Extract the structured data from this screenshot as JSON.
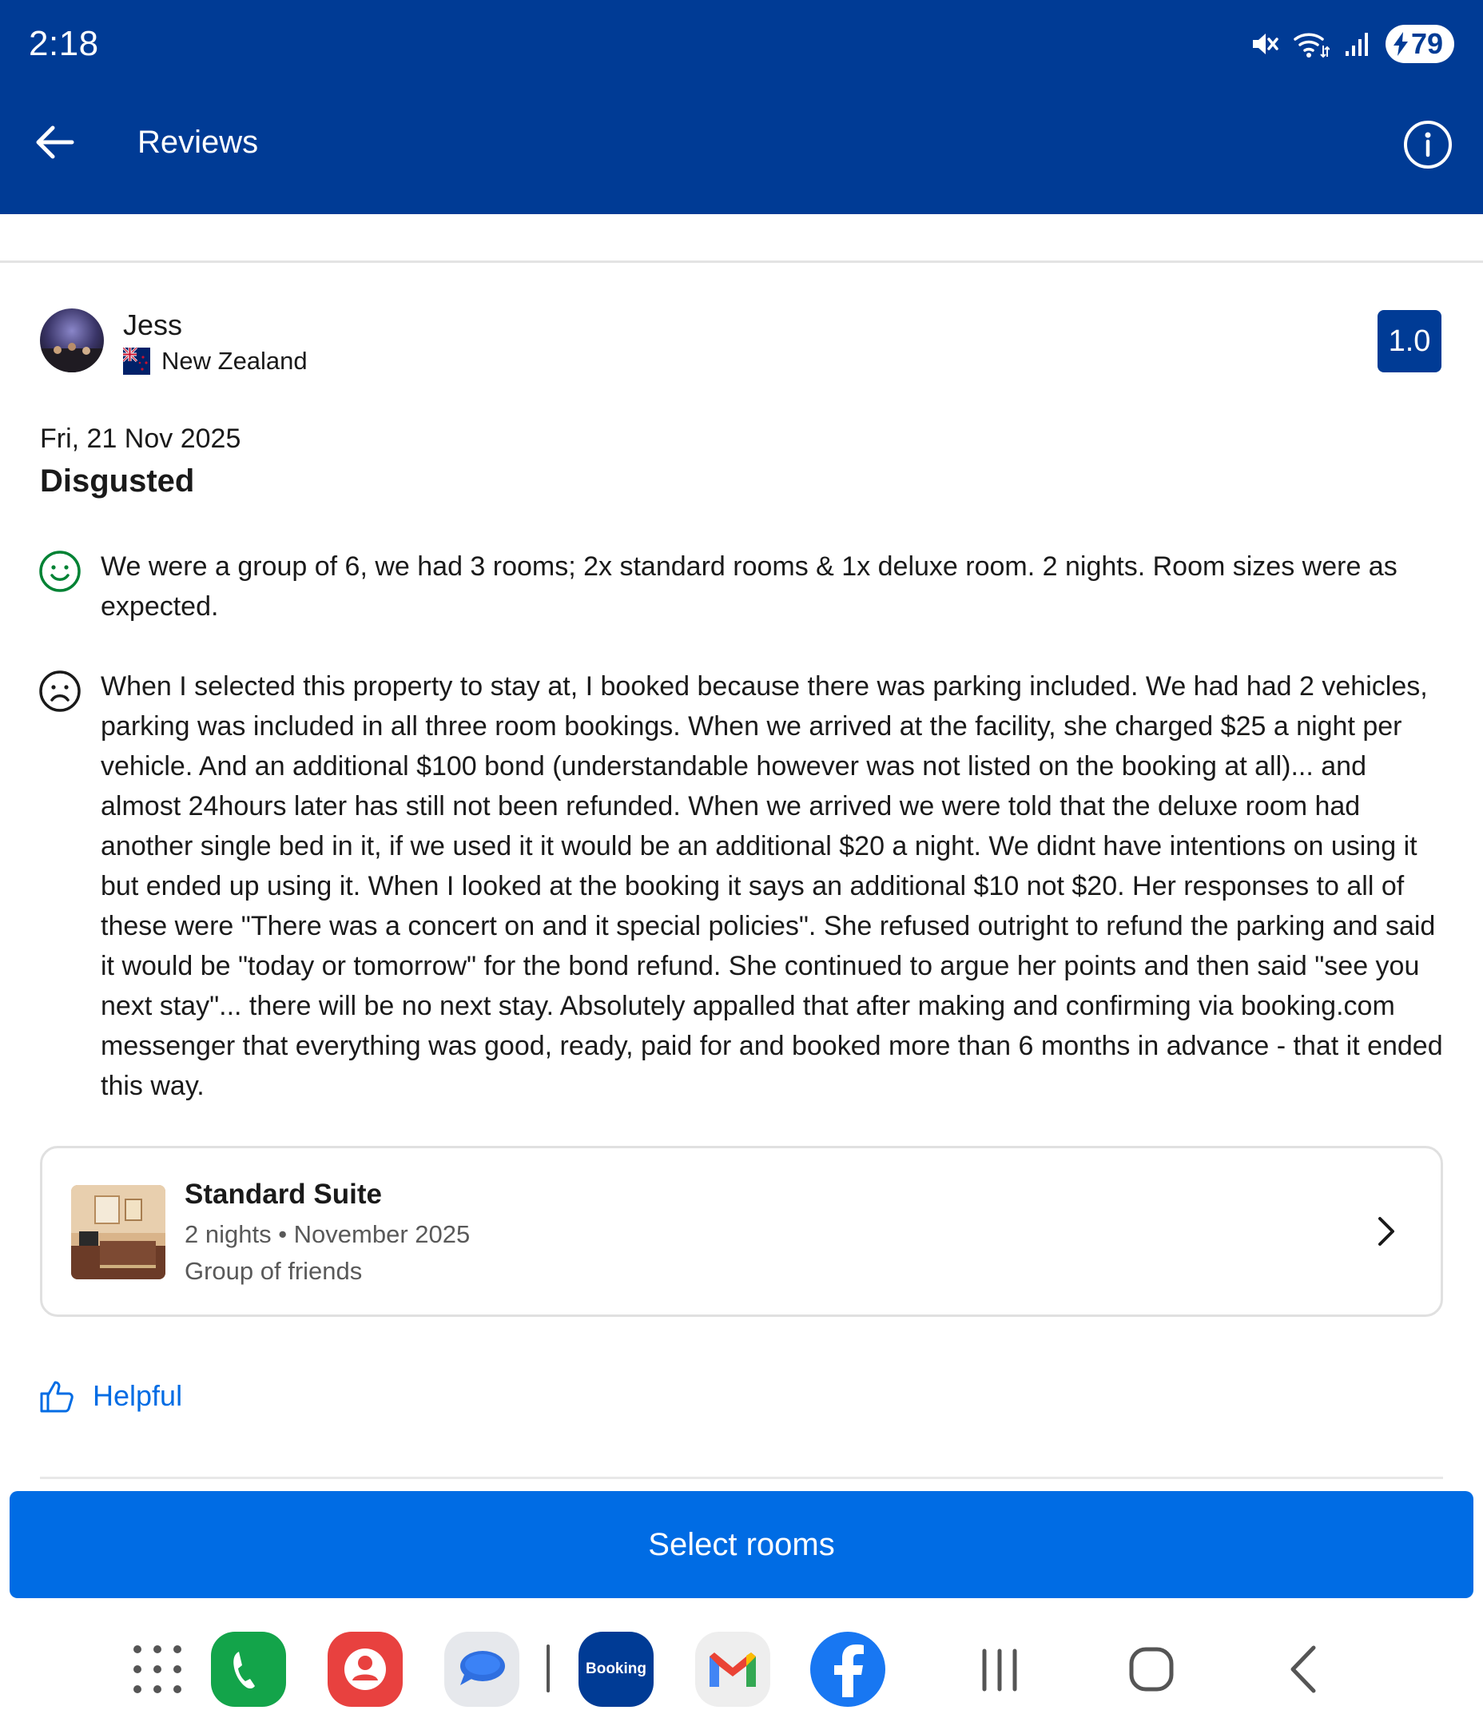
{
  "status_bar": {
    "time": "2:18",
    "battery": "79"
  },
  "app_bar": {
    "title": "Reviews"
  },
  "review": {
    "reviewer_name": "Jess",
    "country": "New Zealand",
    "score": "1.0",
    "date": "Fri, 21 Nov 2025",
    "title": "Disgusted",
    "positive": "We were a group of 6, we had 3 rooms; 2x standard rooms & 1x deluxe room. 2 nights. Room sizes were as expected.",
    "negative": "When I selected this property to stay at, I booked because there was parking included. We had had 2 vehicles, parking was included in all three room bookings. When we arrived at the facility, she charged $25 a night per vehicle. And an additional $100 bond (understandable however was not listed on the booking at all)... and almost 24hours later has still not been refunded. When we arrived we were told that the deluxe room had another single bed in it, if we used it it would be an additional $20 a night. We didnt have intentions on using it but ended up using it. When I looked at the booking it says an additional $10 not $20. Her responses to all of these were \"There was a concert on and it special policies\". She refused outright to refund the parking and said it would be \"today or tomorrow\" for the bond refund. She continued to argue her points and then said \"see you next stay\"... there will be no next stay. Absolutely appalled that after making and confirming via booking.com messenger that everything was good, ready, paid for and booked more than 6 months in advance - that it ended this way."
  },
  "room": {
    "name": "Standard Suite",
    "meta": "2 nights • November 2025",
    "traveler_type": "Group of friends"
  },
  "helpful_label": "Helpful",
  "select_rooms_label": "Select rooms",
  "dock": {
    "apps": [
      "app-drawer-icon",
      "phone-icon",
      "contacts-icon",
      "messages-icon",
      "booking-icon",
      "gmail-icon",
      "facebook-icon"
    ],
    "booking_label": "Booking"
  },
  "colors": {
    "brand_dark": "#003b95",
    "brand_action": "#006ce4",
    "positive": "#008234",
    "border": "#e0e0e0"
  }
}
